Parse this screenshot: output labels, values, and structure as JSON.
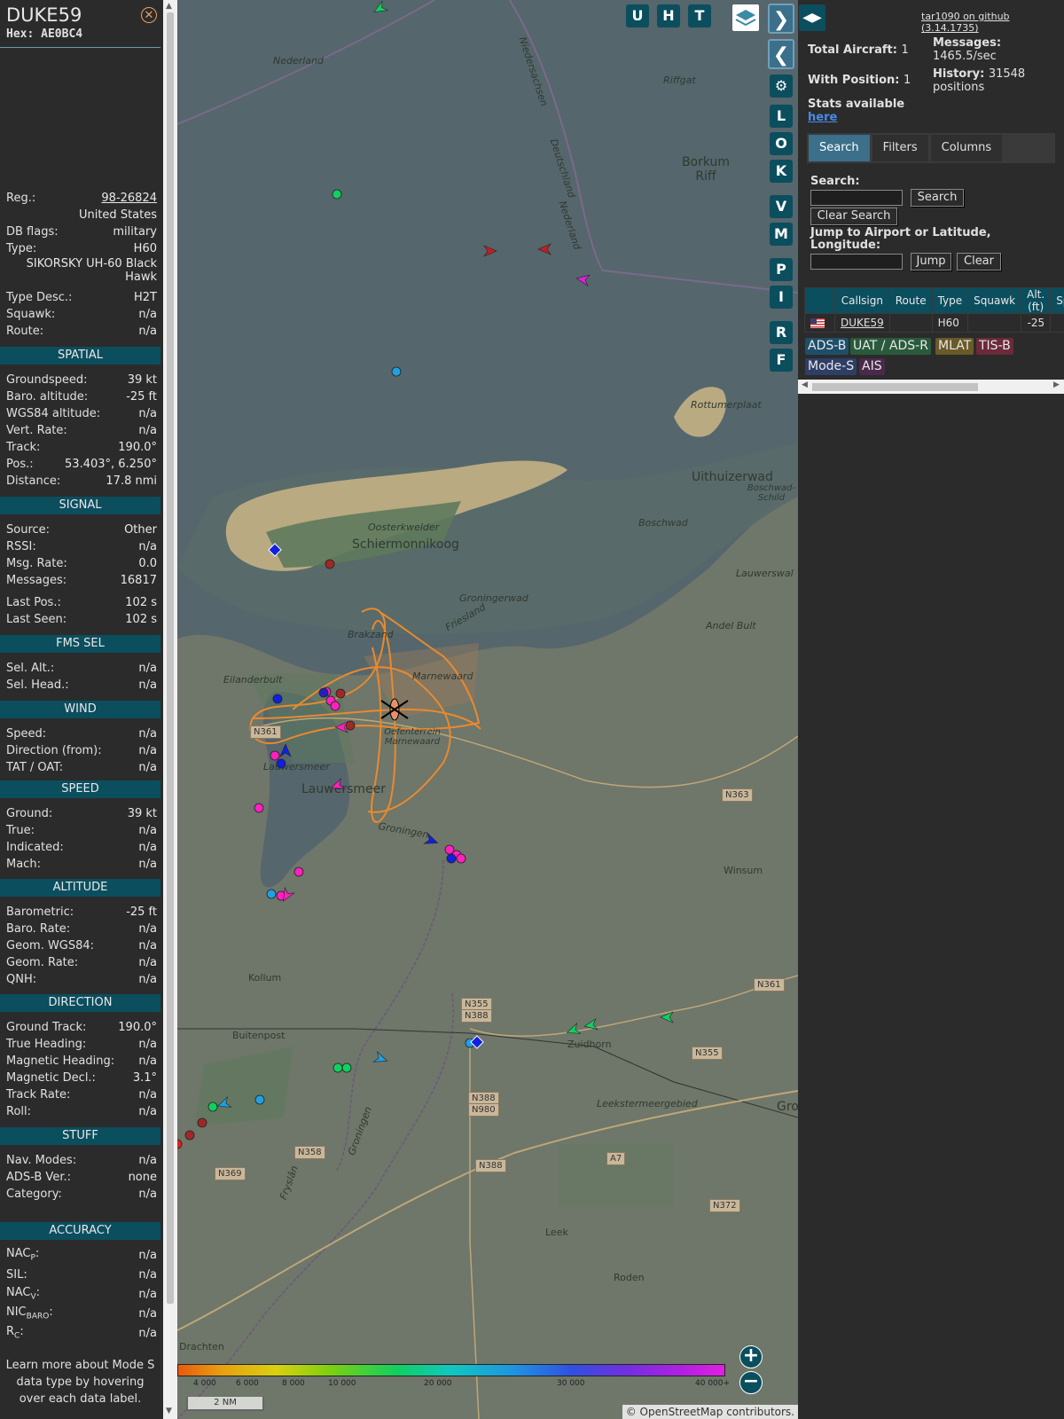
{
  "info": {
    "callsign": "DUKE59",
    "hex_label": "Hex:",
    "hex": "AE0BC4",
    "rows_top": [
      {
        "label": "Reg.:",
        "value": "98-26824"
      },
      {
        "label": "",
        "value": "United States"
      },
      {
        "label": "DB flags:",
        "value": "military"
      },
      {
        "label": "Type:",
        "value": "H60"
      },
      {
        "label": "",
        "value": "SIKORSKY UH-60 Black Hawk"
      },
      {
        "label": "Type Desc.:",
        "value": "H2T"
      },
      {
        "label": "Squawk:",
        "value": "n/a"
      },
      {
        "label": "Route:",
        "value": "n/a"
      }
    ],
    "sections": {
      "spatial": {
        "title": "SPATIAL",
        "rows": [
          {
            "label": "Groundspeed:",
            "value": "39 kt"
          },
          {
            "label": "Baro. altitude:",
            "value": "-25 ft"
          },
          {
            "label": "WGS84 altitude:",
            "value": "n/a"
          },
          {
            "label": "Vert. Rate:",
            "value": "n/a"
          },
          {
            "label": "Track:",
            "value": "190.0°"
          },
          {
            "label": "Pos.:",
            "value": "53.403°, 6.250°"
          },
          {
            "label": "Distance:",
            "value": "17.8 nmi"
          }
        ]
      },
      "signal": {
        "title": "SIGNAL",
        "rows": [
          {
            "label": "Source:",
            "value": "Other"
          },
          {
            "label": "RSSI:",
            "value": "n/a"
          },
          {
            "label": "Msg. Rate:",
            "value": "0.0"
          },
          {
            "label": "Messages:",
            "value": "16817"
          },
          {
            "label": "Last Pos.:",
            "value": "102 s"
          },
          {
            "label": "Last Seen:",
            "value": "102 s"
          }
        ]
      },
      "fms": {
        "title": "FMS SEL",
        "rows": [
          {
            "label": "Sel. Alt.:",
            "value": "n/a"
          },
          {
            "label": "Sel. Head.:",
            "value": "n/a"
          }
        ]
      },
      "wind": {
        "title": "WIND",
        "rows": [
          {
            "label": "Speed:",
            "value": "n/a"
          },
          {
            "label": "Direction (from):",
            "value": "n/a"
          },
          {
            "label": "TAT / OAT:",
            "value": "n/a"
          }
        ]
      },
      "speed": {
        "title": "SPEED",
        "rows": [
          {
            "label": "Ground:",
            "value": "39 kt"
          },
          {
            "label": "True:",
            "value": "n/a"
          },
          {
            "label": "Indicated:",
            "value": "n/a"
          },
          {
            "label": "Mach:",
            "value": "n/a"
          }
        ]
      },
      "altitude": {
        "title": "ALTITUDE",
        "rows": [
          {
            "label": "Barometric:",
            "value": "-25 ft"
          },
          {
            "label": "Baro. Rate:",
            "value": "n/a"
          },
          {
            "label": "Geom. WGS84:",
            "value": "n/a"
          },
          {
            "label": "Geom. Rate:",
            "value": "n/a"
          },
          {
            "label": "QNH:",
            "value": "n/a"
          }
        ]
      },
      "direction": {
        "title": "DIRECTION",
        "rows": [
          {
            "label": "Ground Track:",
            "value": "190.0°"
          },
          {
            "label": "True Heading:",
            "value": "n/a"
          },
          {
            "label": "Magnetic Heading:",
            "value": "n/a"
          },
          {
            "label": "Magnetic Decl.:",
            "value": "3.1°"
          },
          {
            "label": "Track Rate:",
            "value": "n/a"
          },
          {
            "label": "Roll:",
            "value": "n/a"
          }
        ]
      },
      "stuff": {
        "title": "STUFF",
        "rows": [
          {
            "label": "Nav. Modes:",
            "value": "n/a"
          },
          {
            "label": "ADS-B Ver.:",
            "value": "none"
          },
          {
            "label": "Category:",
            "value": "n/a"
          }
        ]
      },
      "accuracy": {
        "title": "ACCURACY",
        "rows": [
          {
            "label": "NAC",
            "sub": "P",
            "value": "n/a"
          },
          {
            "label": "SIL:",
            "sub": "",
            "value": "n/a"
          },
          {
            "label": "NAC",
            "sub": "V",
            "value": "n/a"
          },
          {
            "label": "NIC",
            "sub": "BARO",
            "value": "n/a"
          },
          {
            "label": "R",
            "sub": "C",
            "value": "n/a"
          }
        ]
      }
    },
    "footer_note": "Learn more about Mode S data type by hovering over each data label."
  },
  "map": {
    "top_buttons": [
      "U",
      "H",
      "T"
    ],
    "side_buttons": [
      "L",
      "O",
      "K",
      "V",
      "M",
      "P",
      "I",
      "R",
      "F"
    ],
    "scale_label": "2 NM",
    "attribution_prefix": "© ",
    "attribution_link": "OpenStreetMap",
    "attribution_suffix": " contributors.",
    "altitude_legend": [
      "4 000",
      "6 000",
      "8 000",
      "10 000",
      "20 000",
      "30 000",
      "40 000+"
    ],
    "labels": [
      {
        "text": "Nederland"
      },
      {
        "text": "Niedersachsen"
      },
      {
        "text": "Riffgat"
      },
      {
        "text": "Deutschland"
      },
      {
        "text": "Nederland"
      },
      {
        "text": "Borkum Riff"
      },
      {
        "text": "Rottumerplaat"
      },
      {
        "text": "Uithuizerwad"
      },
      {
        "text": "Boschwad-Schild"
      },
      {
        "text": "Boschwad"
      },
      {
        "text": "Oosterkwelder"
      },
      {
        "text": "Schiermonnikoog"
      },
      {
        "text": "Groningerwad"
      },
      {
        "text": "Lauwerswal"
      },
      {
        "text": "Friesland"
      },
      {
        "text": "Brakzand"
      },
      {
        "text": "Andel Bult"
      },
      {
        "text": "Marnewaard"
      },
      {
        "text": "Eilanderbult"
      },
      {
        "text": "Oefenterrein Marnewaard"
      },
      {
        "text": "Lauwersmeer"
      },
      {
        "text": "Lauwersmeer"
      },
      {
        "text": "Groningen"
      },
      {
        "text": "Winsum"
      },
      {
        "text": "Kollum"
      },
      {
        "text": "Buitenpost"
      },
      {
        "text": "Zuidhorn"
      },
      {
        "text": "Gro"
      },
      {
        "text": "Leekstermeergebied"
      },
      {
        "text": "Leek"
      },
      {
        "text": "Roden"
      },
      {
        "text": "Drachten"
      },
      {
        "text": "Groningen"
      },
      {
        "text": "Fryslân"
      }
    ],
    "road_tags": [
      "N361",
      "N363",
      "N361",
      "N355",
      "N388",
      "N355",
      "N388",
      "N980",
      "N358",
      "N388",
      "A7",
      "N369",
      "N372"
    ]
  },
  "panel": {
    "github_link": "tar1090 on github (3.14.1735)",
    "total_aircraft_label": "Total Aircraft:",
    "total_aircraft": "1",
    "with_position_label": "With Position:",
    "with_position": "1",
    "messages_label": "Messages:",
    "messages": "1465.5/sec",
    "history_label": "History:",
    "history": "31548 positions",
    "stats_label": "Stats available",
    "stats_link": "here",
    "tabs": [
      "Search",
      "Filters",
      "Columns"
    ],
    "search_label": "Search:",
    "search_button": "Search",
    "clear_search_button": "Clear Search",
    "jump_label": "Jump to Airport or Latitude, Longitude:",
    "jump_button": "Jump",
    "clear_button": "Clear",
    "table": {
      "headers": [
        "",
        "Callsign",
        "Route",
        "Type",
        "Squawk",
        "Alt. (ft)",
        "Spd."
      ],
      "rows": [
        {
          "callsign": "DUKE59",
          "route": "",
          "type": "H60",
          "squawk": "",
          "alt": "-25",
          "spd": ""
        }
      ]
    },
    "sources": [
      {
        "label": "ADS-B",
        "color": "#1e4f6a"
      },
      {
        "label": "UAT / ADS-R",
        "color": "#2a5a3c"
      },
      {
        "label": "MLAT",
        "color": "#6a5a28"
      },
      {
        "label": "TIS-B",
        "color": "#6a2a3a"
      },
      {
        "label": "Mode-S",
        "color": "#2e3e66"
      },
      {
        "label": "AIS",
        "color": "#4a2a4a"
      }
    ]
  }
}
